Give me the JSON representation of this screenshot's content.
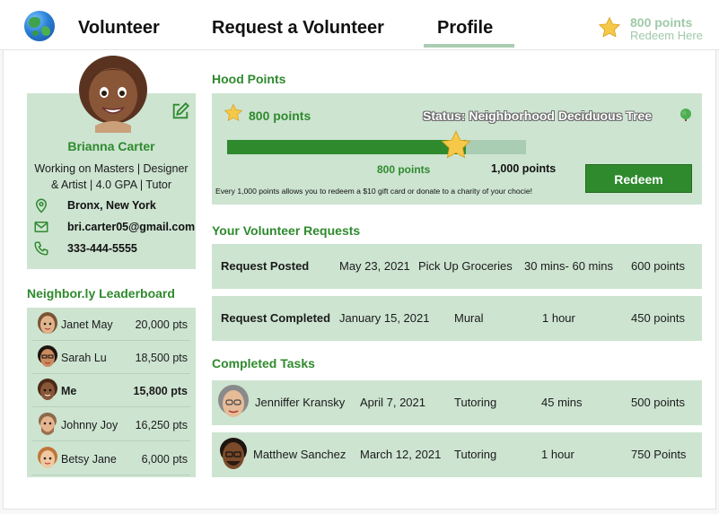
{
  "nav": {
    "links": [
      "Volunteer",
      "Request a Volunteer",
      "Profile"
    ],
    "active": "Profile",
    "points": "800 points",
    "redeem_label": "Redeem Here"
  },
  "profile": {
    "name": "Brianna Carter",
    "bio_line1": "Working on Masters | Designer",
    "bio_line2": "& Artist | 4.0 GPA | Tutor",
    "location": "Bronx, New York",
    "email": "bri.carter05@gmail.com",
    "phone": "333-444-5555"
  },
  "leaderboard": {
    "title": "Neighbor.ly Leaderboard",
    "entries": [
      {
        "name": "Janet May",
        "points": "20,000 pts"
      },
      {
        "name": "Sarah Lu",
        "points": "18,500 pts"
      },
      {
        "name": "Me",
        "points": "15,800 pts"
      },
      {
        "name": "Johnny Joy",
        "points": "16,250 pts"
      },
      {
        "name": "Betsy Jane",
        "points": "6,000 pts"
      }
    ]
  },
  "hood_points": {
    "title": "Hood Points",
    "points": "800 points",
    "status": "Status: Neighborhood Deciduous Tree",
    "current_label": "800 points",
    "goal_label": "1,000 points",
    "progress": 0.8,
    "note": "Every 1,000 points allows you to redeem a $10 gift card or donate to a charity of your chocie!",
    "redeem_label": "Redeem"
  },
  "requests": {
    "title": "Your Volunteer Requests",
    "rows": [
      {
        "status": "Request Posted",
        "date": "May 23, 2021",
        "task": "Pick Up Groceries",
        "duration": "30 mins- 60 mins",
        "points": "600 points"
      },
      {
        "status": "Request Completed",
        "date": "January 15, 2021",
        "task": "Mural",
        "duration": "1 hour",
        "points": "450 points"
      }
    ]
  },
  "completed": {
    "title": "Completed Tasks",
    "rows": [
      {
        "person": "Jenniffer Kransky",
        "date": "April 7, 2021",
        "task": "Tutoring",
        "duration": "45 mins",
        "points": "500 points"
      },
      {
        "person": "Matthew Sanchez",
        "date": "March 12, 2021",
        "task": "Tutoring",
        "duration": "1 hour",
        "points": "750 Points"
      }
    ]
  },
  "colors": {
    "accent_green": "#2f8a2e",
    "card_green": "#cde4d1",
    "light_green": "#a9cdb3",
    "star_yellow": "#f6c84a"
  }
}
